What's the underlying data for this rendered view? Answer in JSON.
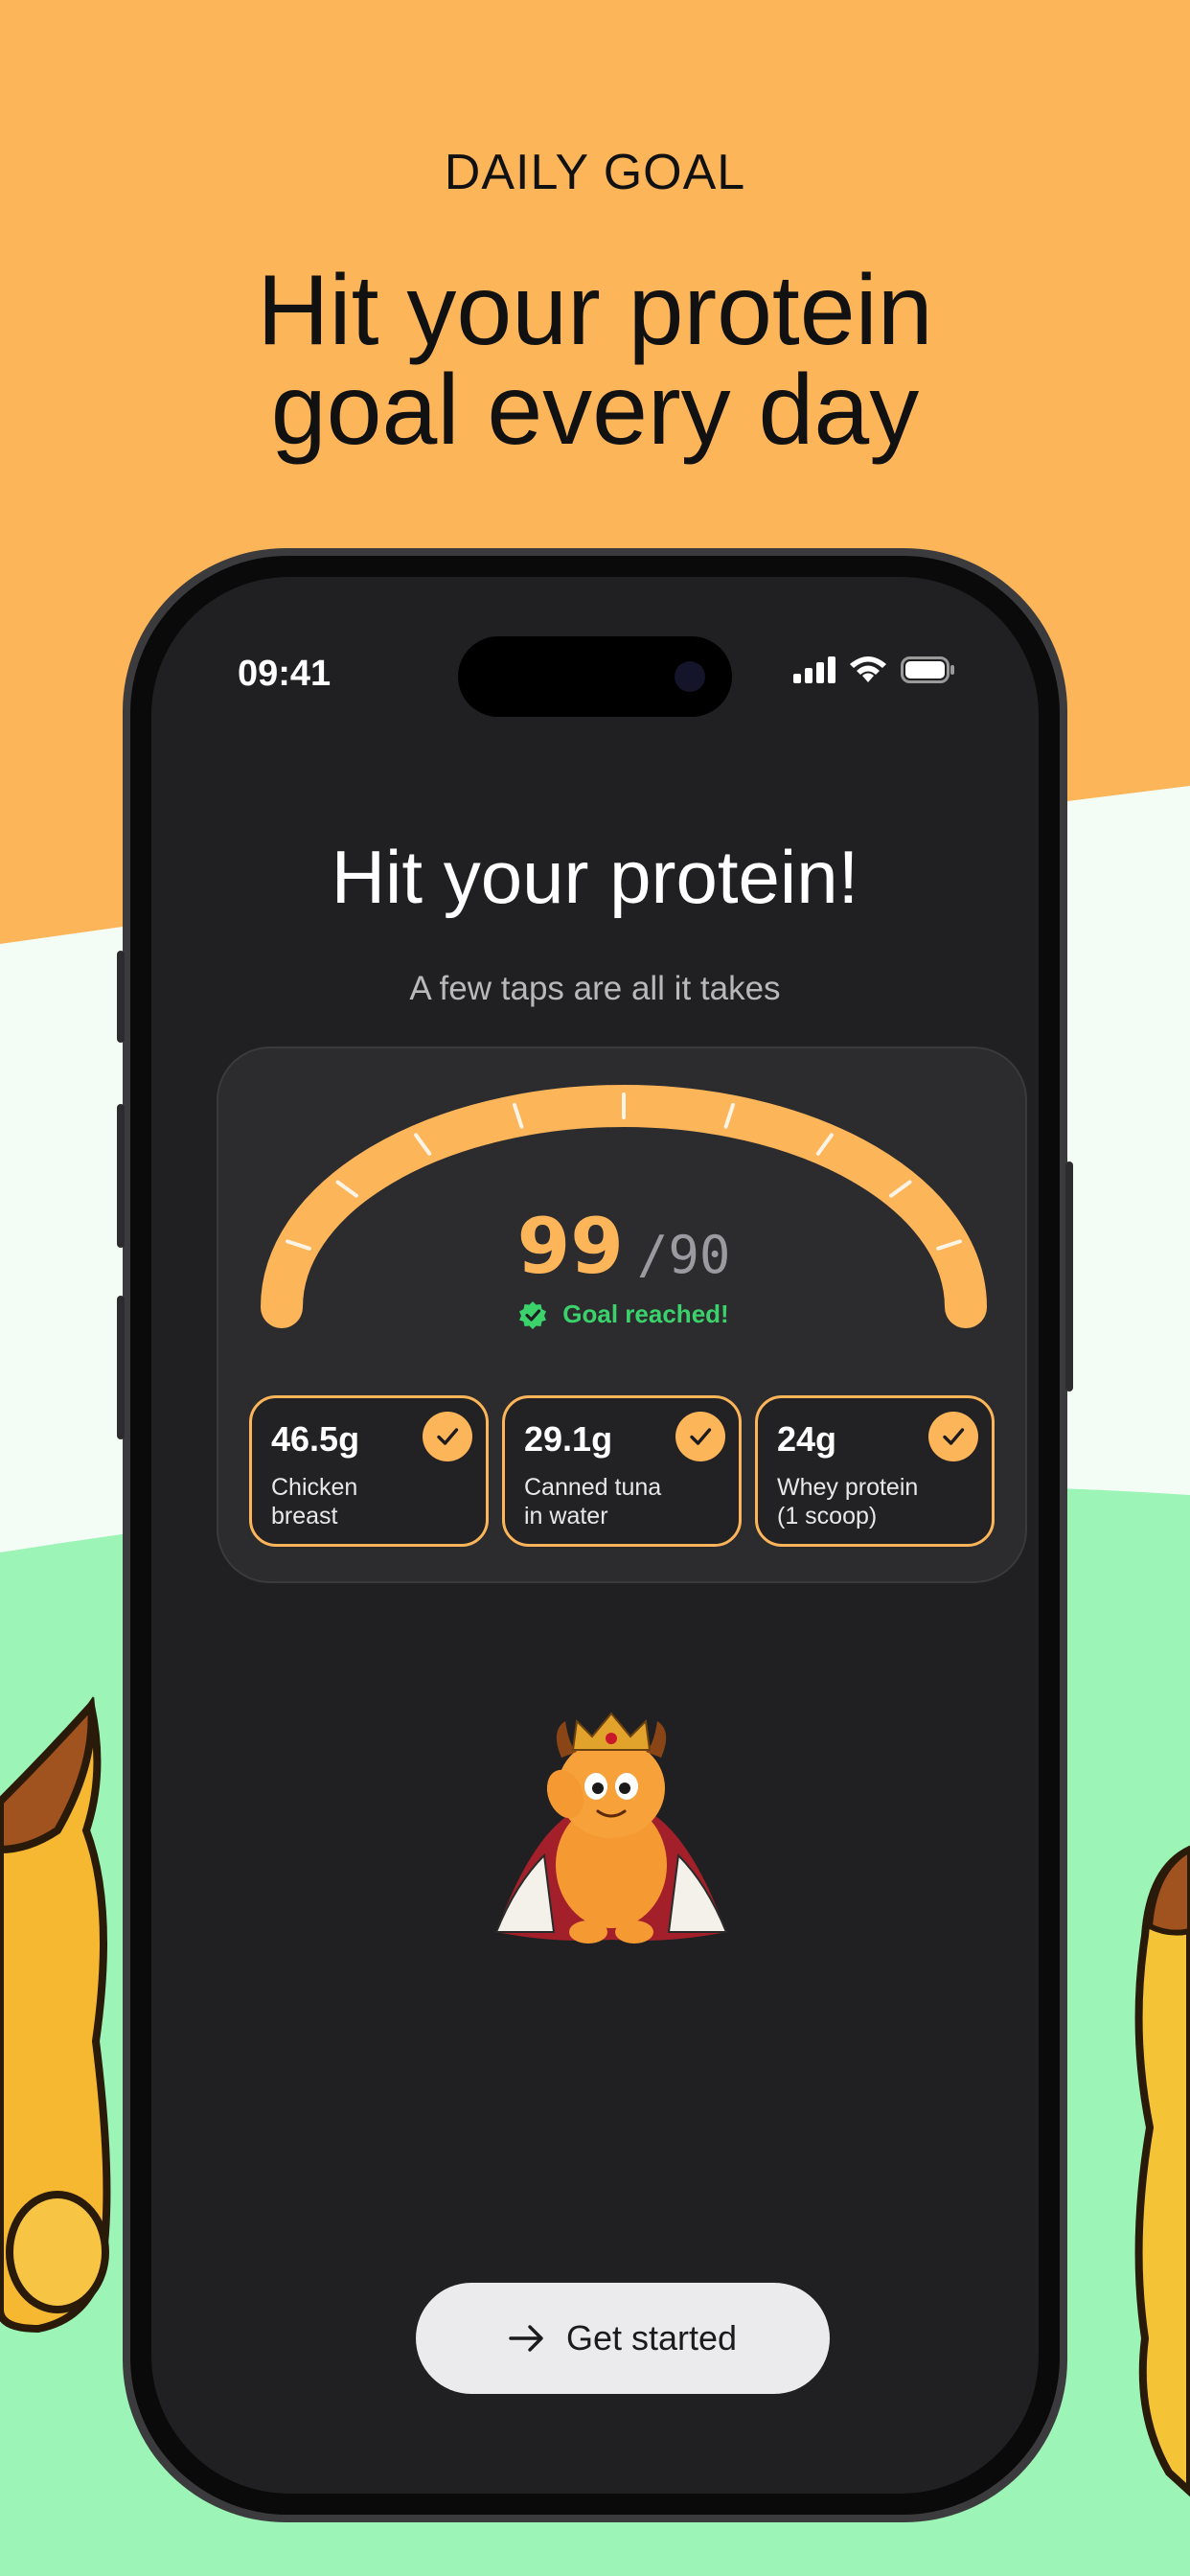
{
  "promo": {
    "eyebrow": "DAILY GOAL",
    "headline_line1": "Hit your protein",
    "headline_line2": "goal every day"
  },
  "status_bar": {
    "time": "09:41",
    "icons": [
      "cellular-signal-icon",
      "wifi-icon",
      "battery-icon"
    ]
  },
  "screen": {
    "title": "Hit your protein!",
    "subtitle": "A few taps are all it takes"
  },
  "progress": {
    "value": "99",
    "goal": "/90",
    "status": "Goal reached!",
    "fraction": 1.0
  },
  "foods": [
    {
      "grams": "46.5g",
      "name": "Chicken\nbreast",
      "checked": true
    },
    {
      "grams": "29.1g",
      "name": "Canned tuna\nin water",
      "checked": true
    },
    {
      "grams": "24g",
      "name": "Whey protein\n(1 scoop)",
      "checked": true
    }
  ],
  "cta": {
    "label": "Get started"
  },
  "colors": {
    "orange": "#fdb55a",
    "mint": "#f3fdf6",
    "green": "#9cf5b6",
    "screen_bg": "#202022",
    "success": "#3bd26c"
  }
}
